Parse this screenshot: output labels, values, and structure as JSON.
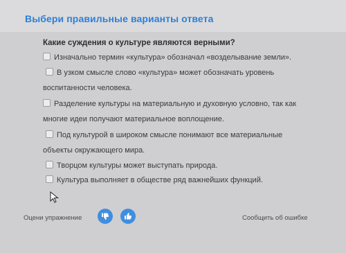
{
  "header": {
    "title": "Выбери правильные варианты ответа"
  },
  "question": "Какие суждения о культуре являются верными?",
  "options": [
    {
      "line1": "Изначально термин «культура» обозначал «возделывание земли».",
      "line2": ""
    },
    {
      "line1": "В узком смысле слово «культура» может обозначать уровень",
      "line2": "воспитанности человека."
    },
    {
      "line1": "Разделение культуры на материальную и духовную условно, так как",
      "line2": "многие идеи получают материальное воплощение."
    },
    {
      "line1": "Под культурой в широком смысле понимают все материальные",
      "line2": "объекты окружающего мира."
    },
    {
      "line1": "Творцом культуры может выступать природа.",
      "line2": ""
    },
    {
      "line1": "Культура выполняет в обществе ряд важнейших функций.",
      "line2": ""
    }
  ],
  "footer": {
    "rate_label": "Оцени упражнение",
    "report_label": "Сообщить об ошибке",
    "thumb_down_icon": "thumb-down-icon",
    "thumb_up_icon": "thumb-up-icon"
  },
  "colors": {
    "accent": "#2e7fd6",
    "button": "#3f8ee0"
  }
}
